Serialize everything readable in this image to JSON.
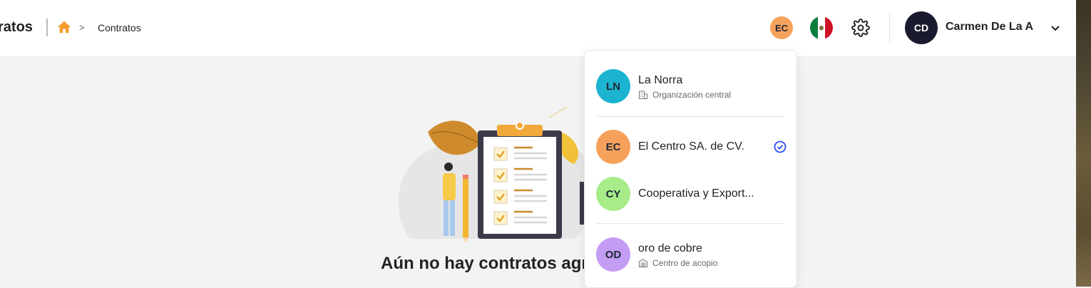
{
  "header": {
    "page_title": "ratos",
    "breadcrumb_current": "Contratos",
    "breadcrumb_separator": ">",
    "org_badge": "EC",
    "user_initials": "CD",
    "user_name": "Carmen De La A"
  },
  "colors": {
    "accent_home": "#f39c2b",
    "org_badge_bg": "#f6a15b",
    "user_avatar_bg": "#1a1a2e",
    "selected_check": "#2b50ff"
  },
  "empty_state": {
    "title": "Aún no hay contratos agregados"
  },
  "org_dropdown": {
    "items": [
      {
        "initials": "LN",
        "name": "La Norra",
        "subtitle": "Organización central",
        "subtitle_icon": "building-icon",
        "color": "#1bb3cf",
        "selected": false
      },
      {
        "initials": "EC",
        "name": "El Centro SA. de CV.",
        "subtitle": "",
        "color": "#f6a15b",
        "selected": true
      },
      {
        "initials": "CY",
        "name": "Cooperativa y Export...",
        "subtitle": "",
        "color": "#a8ec8a",
        "selected": false
      },
      {
        "initials": "OD",
        "name": "oro de cobre",
        "subtitle": "Centro de acopio",
        "subtitle_icon": "warehouse-icon",
        "color": "#c39cf4",
        "selected": false
      }
    ]
  }
}
